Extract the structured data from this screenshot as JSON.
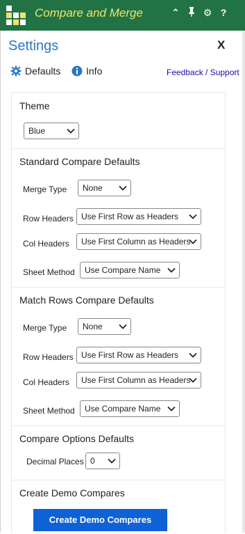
{
  "app": {
    "title": "Compare and Merge"
  },
  "titlebar_icons": [
    "collapse-icon",
    "pin-icon",
    "gear-icon",
    "help-icon"
  ],
  "titlebar_glyphs": {
    "collapse": "⌃",
    "pin": "📌",
    "gear": "⚙",
    "help": "?"
  },
  "header": {
    "title": "Settings",
    "close_label": "X"
  },
  "nav": {
    "defaults_label": "Defaults",
    "info_label": "Info",
    "feedback_label": "Feedback / Support"
  },
  "theme": {
    "title": "Theme",
    "value": "Blue"
  },
  "standard": {
    "title": "Standard Compare Defaults",
    "merge_type_label": "Merge Type",
    "merge_type_value": "None",
    "row_headers_label": "Row Headers",
    "row_headers_value": "Use First Row as Headers",
    "col_headers_label": "Col Headers",
    "col_headers_value": "Use First Column as Headers",
    "sheet_method_label": "Sheet Method",
    "sheet_method_value": "Use Compare Name"
  },
  "match_rows": {
    "title": "Match Rows Compare Defaults",
    "merge_type_label": "Merge Type",
    "merge_type_value": "None",
    "row_headers_label": "Row Headers",
    "row_headers_value": "Use First Row as Headers",
    "col_headers_label": "Col Headers",
    "col_headers_value": "Use First Column as Headers",
    "sheet_method_label": "Sheet Method",
    "sheet_method_value": "Use Compare Name"
  },
  "options": {
    "title": "Compare Options Defaults",
    "decimal_places_label": "Decimal Places",
    "decimal_places_value": "0"
  },
  "demo": {
    "title": "Create Demo Compares",
    "button_label": "Create Demo Compares"
  },
  "colors": {
    "titlebar": "#217346",
    "title_text": "#f0e36a",
    "accent": "#2b78c2",
    "button": "#0f62d6",
    "link": "#1a0dab"
  }
}
